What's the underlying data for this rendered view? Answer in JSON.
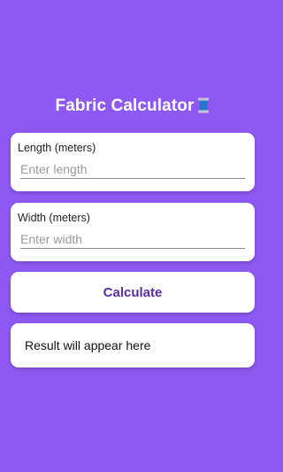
{
  "app": {
    "title": "Fabric Calculator",
    "title_icon": "spool-of-thread-icon"
  },
  "length_field": {
    "label": "Length (meters)",
    "placeholder": "Enter length",
    "value": ""
  },
  "width_field": {
    "label": "Width (meters)",
    "placeholder": "Enter width",
    "value": ""
  },
  "calculate_button": {
    "label": "Calculate"
  },
  "result": {
    "text": "Result will appear here"
  },
  "colors": {
    "background": "#8d59f2",
    "card": "#ffffff",
    "button_text": "#5b2ca0"
  }
}
